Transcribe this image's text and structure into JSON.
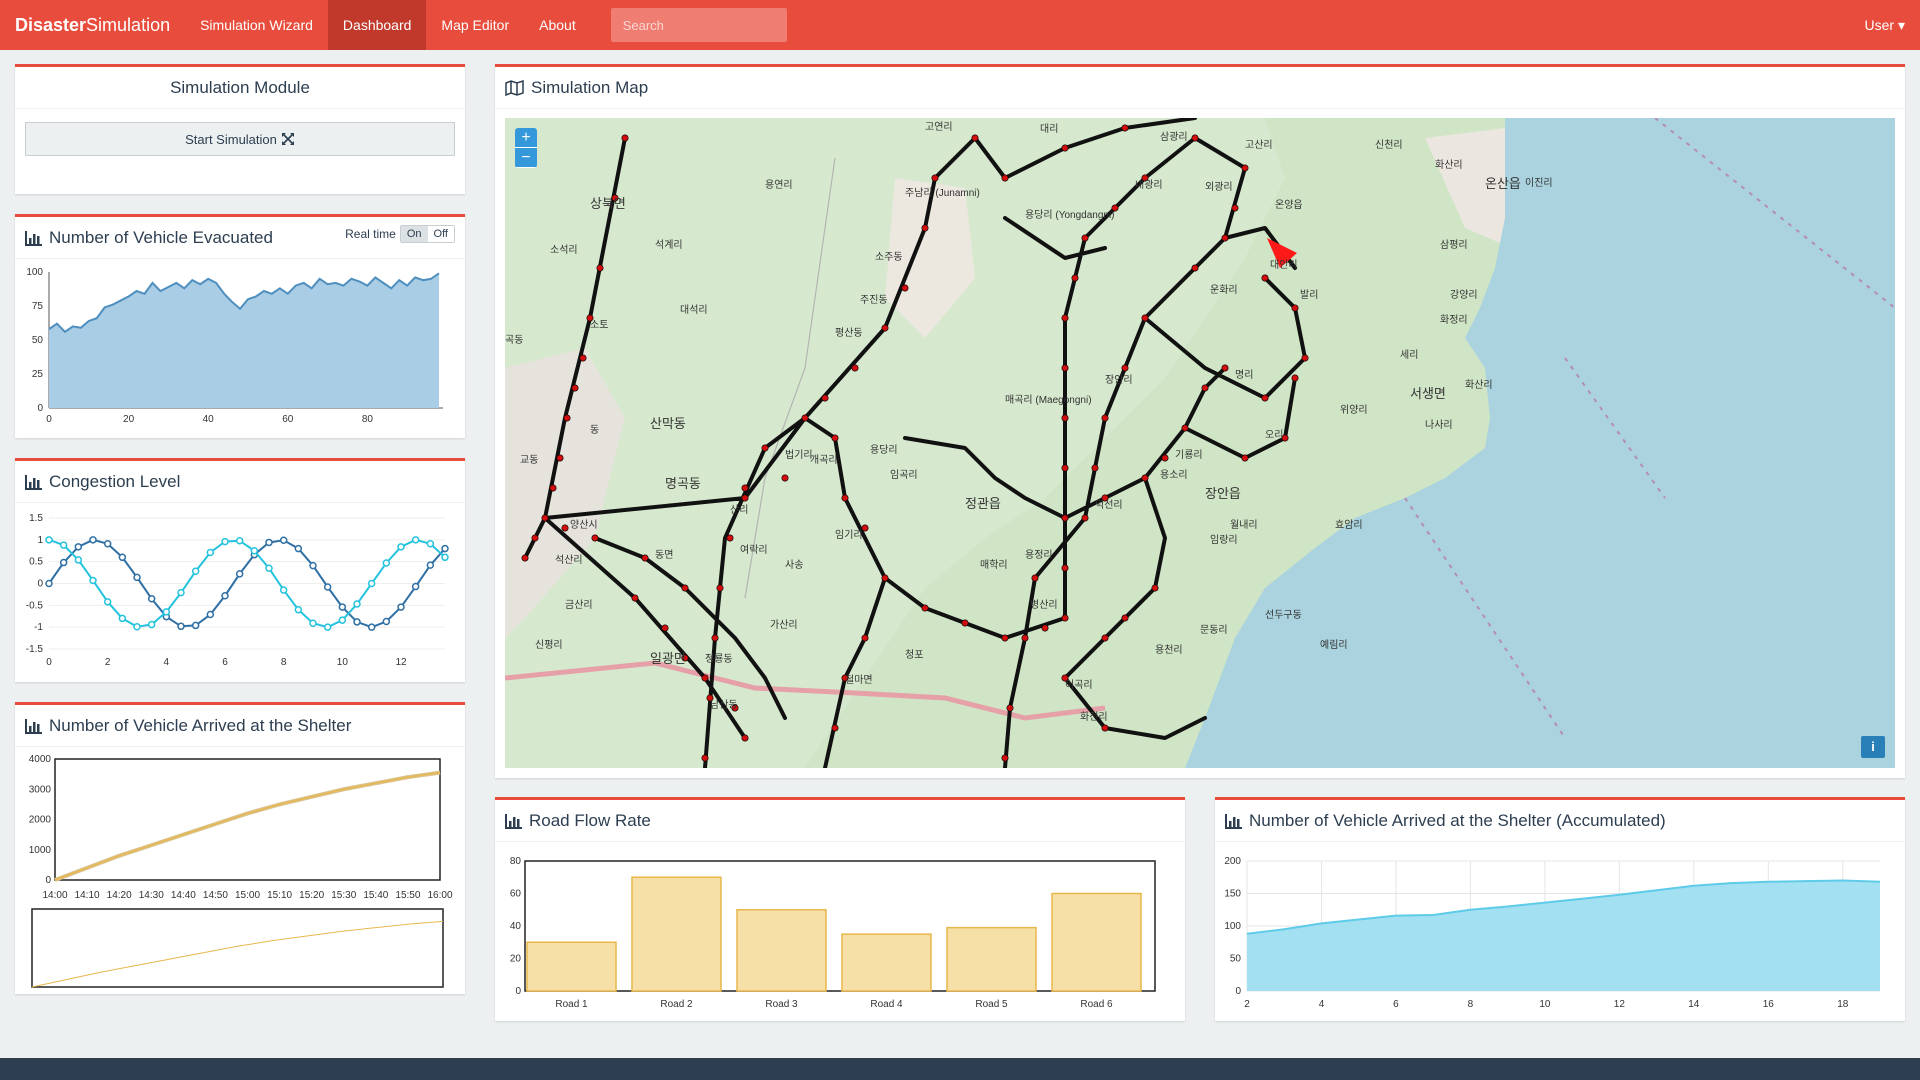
{
  "nav": {
    "brand_bold": "Disaster",
    "brand_rest": "Simulation",
    "items": [
      "Simulation Wizard",
      "Dashboard",
      "Map Editor",
      "About"
    ],
    "search_placeholder": "Search",
    "user": "User ▾"
  },
  "sim_module": {
    "title": "Simulation Module",
    "start_label": "Start Simulation"
  },
  "evacuated": {
    "title": "Number of Vehicle Evacuated",
    "realtime_label": "Real time",
    "on": "On",
    "off": "Off"
  },
  "congestion": {
    "title": "Congestion Level"
  },
  "arrived": {
    "title": "Number of Vehicle Arrived at the Shelter"
  },
  "map": {
    "title": "Simulation Map",
    "zoom_in": "+",
    "zoom_out": "−",
    "info": "i",
    "labels": [
      "고연리",
      "대리",
      "삼광리",
      "고산리",
      "신천리",
      "용연리",
      "주남리 (Junamni)",
      "내광리",
      "외광리",
      "온양읍",
      "화산리",
      "온산읍",
      "이진리",
      "상북면",
      "석계리",
      "용당리 (Yongdangni)",
      "대안리",
      "삼평리",
      "소석리",
      "소주동",
      "운화리",
      "발리",
      "강양리",
      "대석리",
      "주진동",
      "화정리",
      "소토",
      "평산동",
      "세리",
      "곡동",
      "서생면",
      "매곡리 (Maegongni)",
      "장안리",
      "명리",
      "화산리",
      "위양리",
      "나사리",
      "산막동",
      "동",
      "오리",
      "법기리",
      "개곡리",
      "용당리",
      "교동",
      "기룡리",
      "명곡동",
      "임곡리",
      "용소리",
      "장안읍",
      "정관읍",
      "덕선리",
      "산리",
      "효암리",
      "양산시",
      "임기리",
      "월내리",
      "동면",
      "여락리",
      "석산리",
      "매학리",
      "임랑리",
      "용정리",
      "금산리",
      "사송",
      "선두구동",
      "문동리",
      "신평리",
      "가산리",
      "병산리",
      "예림리",
      "용천리",
      "일광면",
      "정룡동",
      "청포",
      "철마면",
      "이곡리",
      "남산동",
      "화전리"
    ],
    "colors": {
      "sea": "#aad3df",
      "land": "#cde3c4",
      "road": "#111111",
      "node": "#d10d0d",
      "rail": "#e6a0a8"
    }
  },
  "road_flow": {
    "title": "Road Flow Rate"
  },
  "accum": {
    "title": "Number of Vehicle Arrived at the Shelter (Accumulated)"
  },
  "chart_data": [
    {
      "type": "area",
      "title": "Number of Vehicle Evacuated",
      "x": [
        0,
        2,
        4,
        6,
        8,
        10,
        12,
        14,
        16,
        18,
        20,
        22,
        24,
        26,
        28,
        30,
        32,
        34,
        36,
        38,
        40,
        42,
        44,
        46,
        48,
        50,
        52,
        54,
        56,
        58,
        60,
        62,
        64,
        66,
        68,
        70,
        72,
        74,
        76,
        78,
        80,
        82,
        84,
        86,
        88,
        90,
        92,
        94,
        96,
        98
      ],
      "values": [
        58,
        62,
        56,
        60,
        59,
        64,
        66,
        74,
        76,
        79,
        82,
        86,
        84,
        92,
        86,
        89,
        92,
        88,
        94,
        91,
        95,
        92,
        84,
        78,
        73,
        80,
        82,
        86,
        84,
        88,
        84,
        90,
        92,
        88,
        95,
        91,
        92,
        90,
        95,
        93,
        90,
        96,
        92,
        88,
        94,
        90,
        96,
        94,
        95,
        99
      ],
      "xlim": [
        0,
        99
      ],
      "ylim": [
        0,
        100
      ],
      "xticks": [
        0,
        20,
        40,
        60,
        80
      ],
      "yticks": [
        0,
        25,
        50,
        75,
        100
      ],
      "color": "#4e8fbf"
    },
    {
      "type": "line",
      "title": "Congestion Level",
      "x": [
        0,
        0.5,
        1,
        1.5,
        2,
        2.5,
        3,
        3.5,
        4,
        4.5,
        5,
        5.5,
        6,
        6.5,
        7,
        7.5,
        8,
        8.5,
        9,
        9.5,
        10,
        10.5,
        11,
        11.5,
        12,
        12.5,
        13,
        13.5
      ],
      "series": [
        {
          "values": [
            0,
            0.48,
            0.84,
            1,
            0.91,
            0.6,
            0.14,
            -0.35,
            -0.76,
            -0.98,
            -0.96,
            -0.71,
            -0.28,
            0.22,
            0.66,
            0.94,
            0.99,
            0.8,
            0.41,
            -0.08,
            -0.54,
            -0.88,
            -1,
            -0.87,
            -0.54,
            -0.07,
            0.42,
            0.8
          ],
          "color": "#2f6fa4"
        },
        {
          "values": [
            1,
            0.88,
            0.54,
            0.07,
            -0.42,
            -0.8,
            -0.99,
            -0.94,
            -0.65,
            -0.21,
            0.28,
            0.71,
            0.96,
            0.98,
            0.75,
            0.35,
            -0.15,
            -0.6,
            -0.91,
            -1,
            -0.84,
            -0.47,
            0.0,
            0.47,
            0.84,
            1,
            0.91,
            0.6
          ],
          "color": "#24c3dd"
        }
      ],
      "xlim": [
        0,
        13.5
      ],
      "ylim": [
        -1.5,
        1.5
      ],
      "xticks": [
        0,
        2,
        4,
        6,
        8,
        10,
        12
      ],
      "yticks": [
        -1.5,
        -1.0,
        -0.5,
        0.0,
        0.5,
        1.0,
        1.5
      ]
    },
    {
      "type": "line",
      "title": "Number of Vehicle Arrived at the Shelter",
      "categories": [
        "14:00",
        "14:10",
        "14:20",
        "14:30",
        "14:40",
        "14:50",
        "15:00",
        "15:10",
        "15:20",
        "15:30",
        "15:40",
        "15:50",
        "16:00"
      ],
      "values": [
        0,
        400,
        800,
        1150,
        1500,
        1850,
        2200,
        2500,
        2750,
        3000,
        3200,
        3400,
        3550
      ],
      "ylim": [
        0,
        4000
      ],
      "yticks": [
        0,
        1000,
        2000,
        3000,
        4000
      ],
      "color": "#e8b74c"
    },
    {
      "type": "bar",
      "title": "Road Flow Rate",
      "categories": [
        "Road 1",
        "Road 2",
        "Road 3",
        "Road 4",
        "Road 5",
        "Road 6"
      ],
      "values": [
        30,
        70,
        50,
        35,
        39,
        60
      ],
      "ylim": [
        0,
        80
      ],
      "yticks": [
        0,
        20,
        40,
        60,
        80
      ],
      "color": "#f6e0a8"
    },
    {
      "type": "area",
      "title": "Number of Vehicle Arrived at the Shelter (Accumulated)",
      "x": [
        2,
        3,
        4,
        5,
        6,
        7,
        8,
        9,
        10,
        11,
        12,
        13,
        14,
        15,
        16,
        17,
        18,
        19
      ],
      "values": [
        88,
        95,
        104,
        110,
        116,
        117,
        125,
        130,
        136,
        142,
        148,
        155,
        162,
        166,
        168,
        169,
        170,
        168
      ],
      "xlim": [
        2,
        19
      ],
      "ylim": [
        0,
        200
      ],
      "xticks": [
        2,
        4,
        6,
        8,
        10,
        12,
        14,
        16,
        18
      ],
      "yticks": [
        0,
        50,
        100,
        150,
        200
      ],
      "color": "#5ecbe8"
    }
  ]
}
